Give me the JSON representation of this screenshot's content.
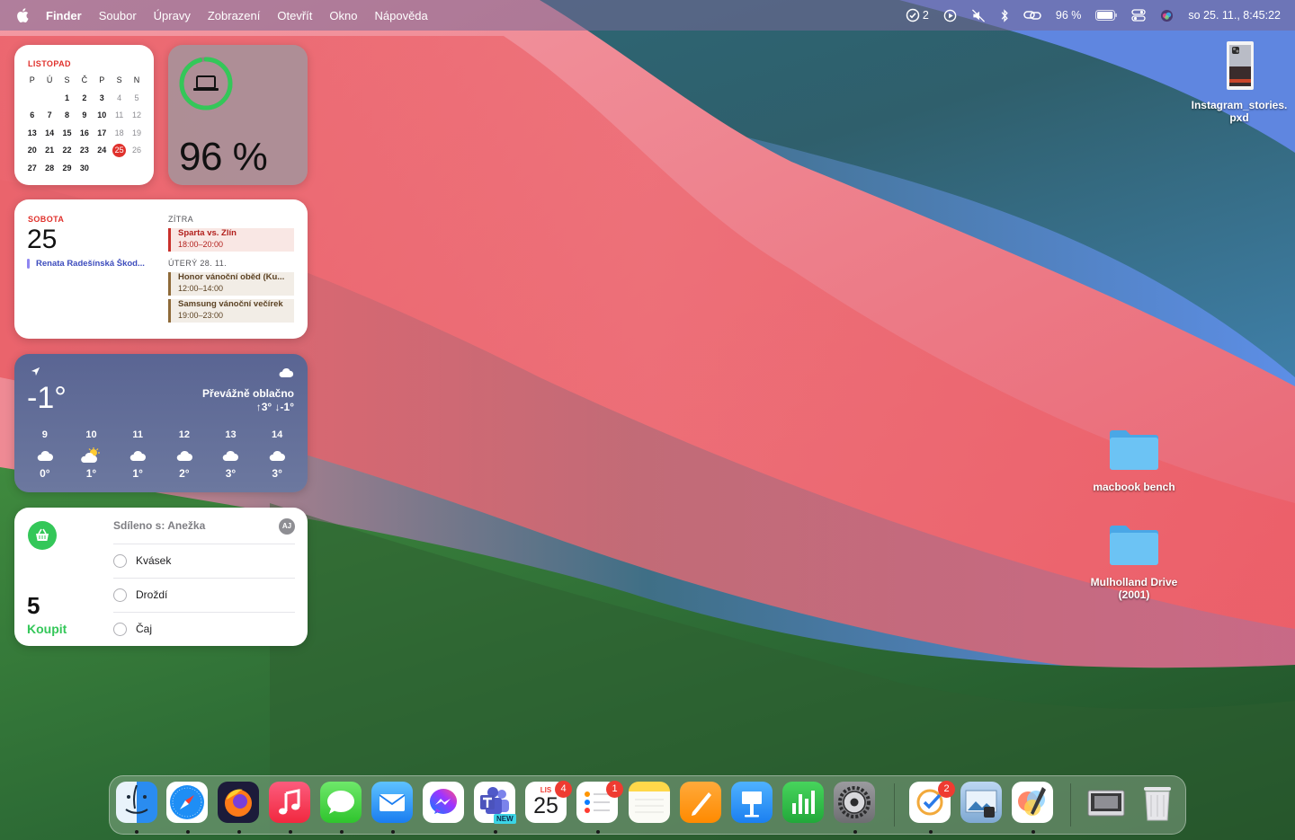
{
  "menubar": {
    "app_name": "Finder",
    "menus": [
      "Soubor",
      "Úpravy",
      "Zobrazení",
      "Otevřít",
      "Okno",
      "Nápověda"
    ],
    "tasks_count": "2",
    "battery_pct": "96 %",
    "datetime": "so 25. 11., 8:45:22"
  },
  "calendar_month": {
    "month": "LISTOPAD",
    "weekdays": [
      "P",
      "Ú",
      "S",
      "Č",
      "P",
      "S",
      "N"
    ],
    "leading_blanks": 2,
    "days_in_month": 30,
    "today": 25
  },
  "battery_widget": {
    "percent": "96 %",
    "level": 0.96
  },
  "events_widget": {
    "day_name": "SOBOTA",
    "day_number": "25",
    "all_day_event": "Renata Radešínská Škod...",
    "section_tomorrow": "ZÍTRA",
    "event1": {
      "title": "Sparta vs. Zlín",
      "time": "18:00–20:00"
    },
    "section_tuesday": "ÚTERÝ 28. 11.",
    "event2": {
      "title": "Honor vánoční oběd (Ku...",
      "time": "12:00–14:00"
    },
    "event3": {
      "title": "Samsung vánoční večírek",
      "time": "19:00–23:00"
    }
  },
  "weather": {
    "temp": "-1°",
    "condition": "Převážně oblačno",
    "hilo": "↑3° ↓-1°",
    "hours": [
      "9",
      "10",
      "11",
      "12",
      "13",
      "14"
    ],
    "icons": [
      "cloud-icon",
      "partly-sunny-icon",
      "cloud-icon",
      "cloud-icon",
      "cloud-icon",
      "cloud-icon"
    ],
    "temps": [
      "0°",
      "1°",
      "1°",
      "2°",
      "3°",
      "3°"
    ]
  },
  "reminders": {
    "count": "5",
    "list_name": "Koupit",
    "shared_with": "Sdíleno s: Anežka",
    "avatar": "AJ",
    "items": [
      "Kvásek",
      "Droždí",
      "Čaj"
    ]
  },
  "desktop": {
    "file1": {
      "name_line1": "Instagram_stories.",
      "name_line2": "pxd"
    },
    "folder1": {
      "name": "macbook bench"
    },
    "folder2": {
      "name_line1": "Mulholland Drive",
      "name_line2": "(2001)"
    }
  },
  "dock": {
    "calendar_month": "LIS",
    "calendar_day": "25",
    "calendar_badge": "4",
    "reminders_badge": "1",
    "tasks_badge": "2",
    "teams_label": "NEW"
  },
  "colors": {
    "accent_red": "#e0312c",
    "reminders_green": "#34c759",
    "badge_red": "#ef3b31",
    "folder_blue": "#6cc3f4"
  }
}
